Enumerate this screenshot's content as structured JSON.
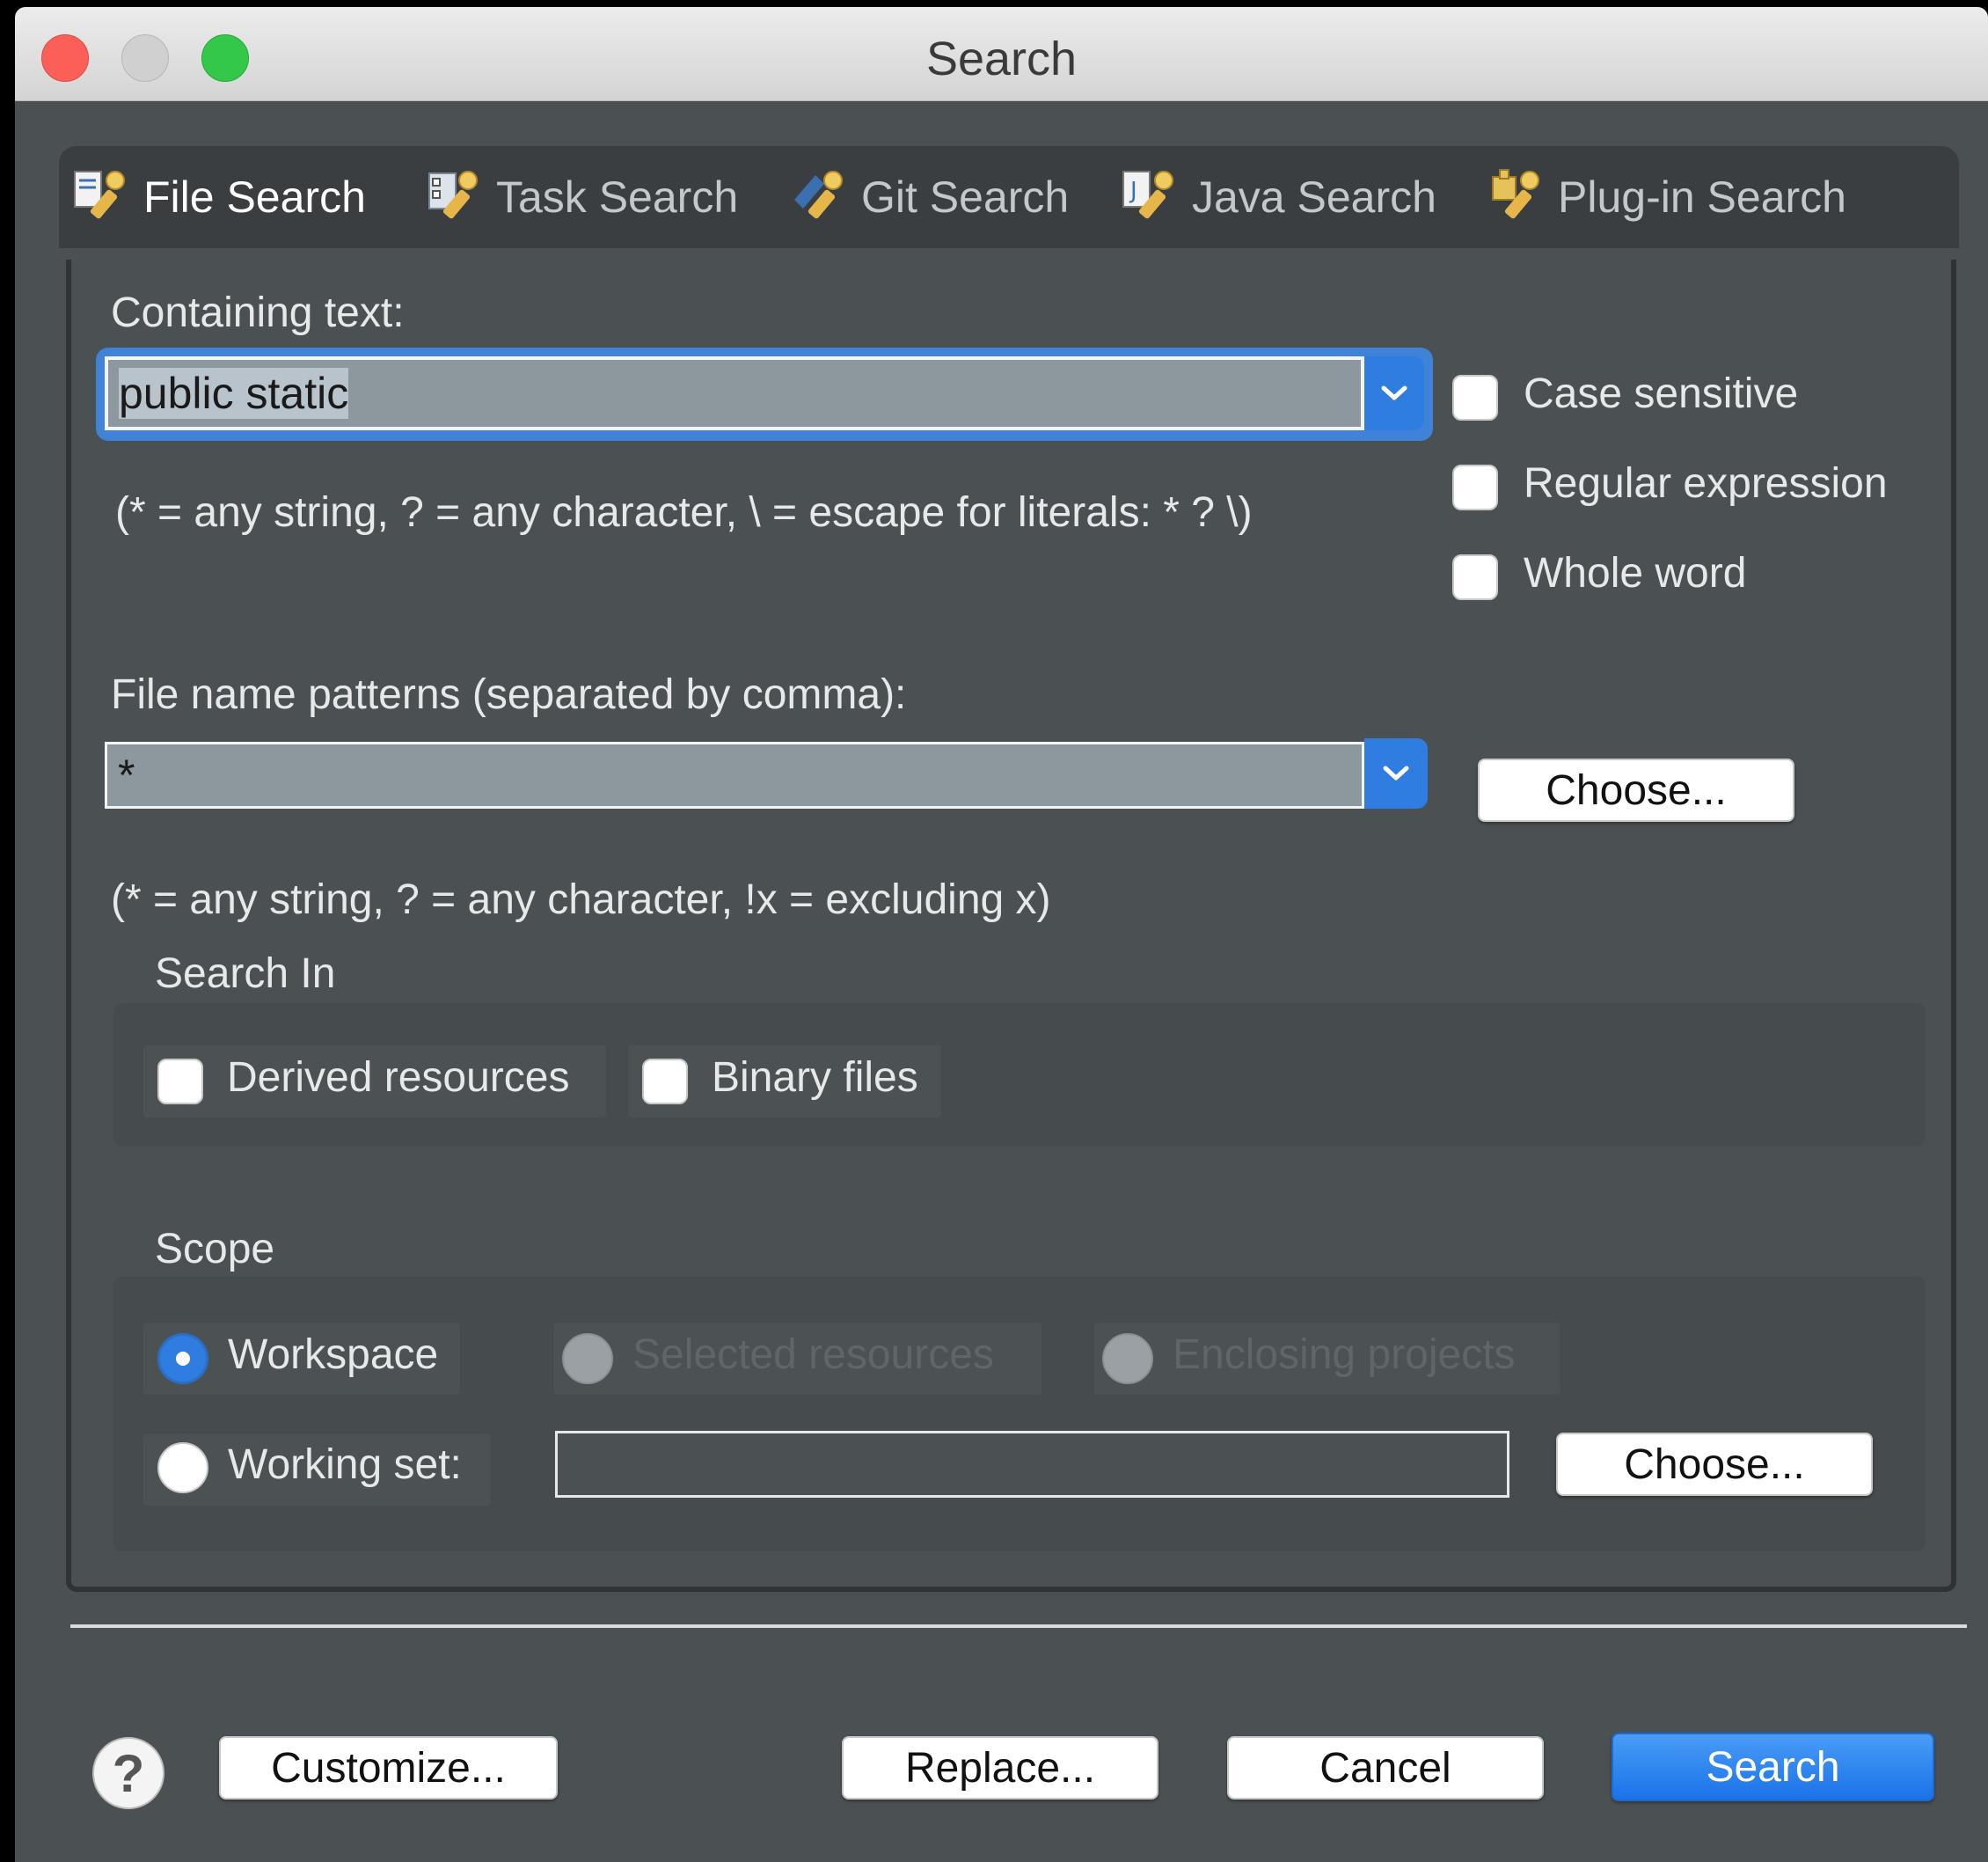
{
  "window": {
    "title": "Search"
  },
  "tabs": [
    {
      "label": "File Search",
      "active": true,
      "icon": "file-search-icon"
    },
    {
      "label": "Task Search",
      "active": false,
      "icon": "task-search-icon"
    },
    {
      "label": "Git Search",
      "active": false,
      "icon": "git-search-icon"
    },
    {
      "label": "Java Search",
      "active": false,
      "icon": "java-search-icon"
    },
    {
      "label": "Plug-in Search",
      "active": false,
      "icon": "plugin-search-icon"
    }
  ],
  "containing_text": {
    "label": "Containing text:",
    "value": "public static",
    "hint": "(* = any string, ? = any character, \\ = escape for literals: * ? \\)"
  },
  "options": {
    "case_sensitive": {
      "label": "Case sensitive",
      "checked": false
    },
    "regular_expression": {
      "label": "Regular expression",
      "checked": false
    },
    "whole_word": {
      "label": "Whole word",
      "checked": false
    }
  },
  "file_patterns": {
    "label": "File name patterns (separated by comma):",
    "value": "*",
    "hint": "(* = any string, ? = any character, !x = excluding x)",
    "choose_label": "Choose..."
  },
  "search_in": {
    "title": "Search In",
    "derived_resources": {
      "label": "Derived resources",
      "checked": false
    },
    "binary_files": {
      "label": "Binary files",
      "checked": false
    }
  },
  "scope": {
    "title": "Scope",
    "workspace": {
      "label": "Workspace",
      "selected": true
    },
    "selected_resources": {
      "label": "Selected resources",
      "enabled": false
    },
    "enclosing_projects": {
      "label": "Enclosing projects",
      "enabled": false
    },
    "working_set": {
      "label": "Working set:",
      "value": "",
      "choose_label": "Choose..."
    }
  },
  "footer": {
    "help": "?",
    "customize_label": "Customize...",
    "replace_label": "Replace...",
    "cancel_label": "Cancel",
    "search_label": "Search"
  },
  "colors": {
    "background": "#4b5052",
    "accent": "#2f7de0",
    "tab_bar": "#3a3e40"
  }
}
